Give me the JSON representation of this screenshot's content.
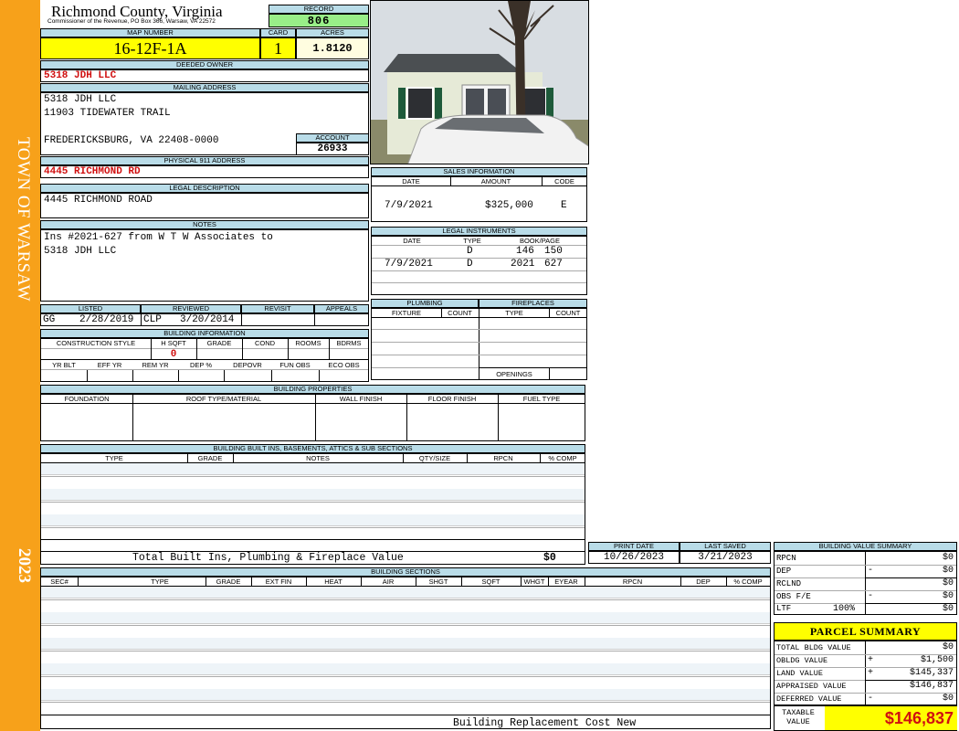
{
  "sidebar": {
    "town": "TOWN OF WARSAW",
    "year": "2023"
  },
  "header": {
    "county": "Richmond County, Virginia",
    "address": "Commissioner of the Revenue, PO Box 366, Warsaw, VA 22572",
    "record_label": "RECORD",
    "record_value": "806",
    "map_label": "MAP NUMBER",
    "map_value": "16-12F-1A",
    "card_label": "CARD",
    "card_value": "1",
    "acres_label": "ACRES",
    "acres_value": "1.8120"
  },
  "owner": {
    "label": "DEEDED OWNER",
    "value": "5318 JDH LLC"
  },
  "mailing": {
    "label": "MAILING ADDRESS",
    "line1": "5318 JDH LLC",
    "line2": "11903 TIDEWATER TRAIL",
    "line3": "FREDERICKSBURG, VA 22408-0000",
    "account_label": "ACCOUNT",
    "account_value": "26933"
  },
  "physical": {
    "label": "PHYSICAL 911 ADDRESS",
    "value": "4445 RICHMOND RD"
  },
  "legal": {
    "label": "LEGAL DESCRIPTION",
    "value": "4445 RICHMOND ROAD"
  },
  "notes": {
    "label": "NOTES",
    "line1": "Ins #2021-627 from W T W Associates to",
    "line2": "5318 JDH LLC"
  },
  "review": {
    "headers": [
      "LISTED",
      "REVIEWED",
      "REVISIT",
      "APPEALS"
    ],
    "listed_by": "GG",
    "listed_date": "2/28/2019",
    "reviewed_by": "CLP",
    "reviewed_date": "3/20/2014"
  },
  "building_info": {
    "label": "BUILDING INFORMATION",
    "row1": [
      "CONSTRUCTION STYLE",
      "H SQFT",
      "GRADE",
      "COND",
      "ROOMS",
      "BDRMS"
    ],
    "hsqft_value": "0",
    "row2": [
      "YR BLT",
      "EFF YR",
      "REM YR",
      "DEP %",
      "DEPOVR",
      "FUN OBS",
      "ECO OBS"
    ]
  },
  "sales": {
    "label": "SALES INFORMATION",
    "cols": [
      "DATE",
      "AMOUNT",
      "CODE"
    ],
    "rows": [
      {
        "date": "7/9/2021",
        "amount": "$325,000",
        "code": "E"
      }
    ]
  },
  "instruments": {
    "label": "LEGAL INSTRUMENTS",
    "cols": [
      "DATE",
      "TYPE",
      "BOOK/PAGE"
    ],
    "rows": [
      {
        "date": "",
        "type": "D",
        "book": "146",
        "page": "150"
      },
      {
        "date": "7/9/2021",
        "type": "D",
        "book": "2021",
        "page": "627"
      }
    ]
  },
  "plumbing": {
    "label": "PLUMBING",
    "cols": [
      "FIXTURE",
      "COUNT"
    ]
  },
  "fireplaces": {
    "label": "FIREPLACES",
    "cols": [
      "TYPE",
      "COUNT"
    ],
    "openings": "OPENINGS"
  },
  "properties": {
    "label": "BUILDING PROPERTIES",
    "cols": [
      "FOUNDATION",
      "ROOF TYPE/MATERIAL",
      "WALL FINISH",
      "FLOOR FINISH",
      "FUEL TYPE"
    ]
  },
  "builtins": {
    "label": "BUILDING BUILT INS, BASEMENTS, ATTICS & SUB SECTIONS",
    "cols": [
      "TYPE",
      "GRADE",
      "NOTES",
      "QTY/SIZE",
      "RPCN",
      "% COMP"
    ],
    "total_label": "Total Built Ins, Plumbing & Fireplace Value",
    "total_value": "$0"
  },
  "print": {
    "print_label": "PRINT DATE",
    "print_value": "10/26/2023",
    "saved_label": "LAST SAVED",
    "saved_value": "3/21/2023"
  },
  "sections": {
    "label": "BUILDING SECTIONS",
    "cols": [
      "SEC#",
      "TYPE",
      "GRADE",
      "EXT FIN",
      "HEAT",
      "AIR",
      "SHGT",
      "SQFT",
      "WHGT",
      "EYEAR",
      "RPCN",
      "DEP",
      "% COMP"
    ],
    "footer": "Building Replacement Cost New"
  },
  "value_summary": {
    "label": "BUILDING VALUE SUMMARY",
    "rows": [
      {
        "label": "RPCN",
        "sign": "",
        "pct": "",
        "value": "$0"
      },
      {
        "label": "DEP",
        "sign": "-",
        "pct": "",
        "value": "$0"
      },
      {
        "label": "RCLND",
        "sign": "",
        "pct": "",
        "value": "$0"
      },
      {
        "label": "OBS F/E",
        "sign": "-",
        "pct": "",
        "value": "$0"
      },
      {
        "label": "LTF",
        "sign": "",
        "pct": "100%",
        "value": "$0"
      }
    ]
  },
  "parcel": {
    "label": "PARCEL SUMMARY",
    "rows": [
      {
        "label": "TOTAL BLDG VALUE",
        "sign": "",
        "value": "$0"
      },
      {
        "label": "OBLDG VALUE",
        "sign": "+",
        "value": "$1,500"
      },
      {
        "label": "LAND VALUE",
        "sign": "+",
        "value": "$145,337"
      },
      {
        "label": "APPRAISED VALUE",
        "sign": "",
        "value": "$146,837"
      },
      {
        "label": "DEFERRED VALUE",
        "sign": "-",
        "value": "$0"
      }
    ],
    "taxable_label1": "TAXABLE",
    "taxable_label2": "VALUE",
    "taxable_value": "$146,837"
  },
  "colors": {
    "sidebar": "#f7a11a",
    "header_blue": "#b9dce8",
    "yellow": "#ffff00",
    "green": "#99ee88",
    "red": "#d01010"
  }
}
